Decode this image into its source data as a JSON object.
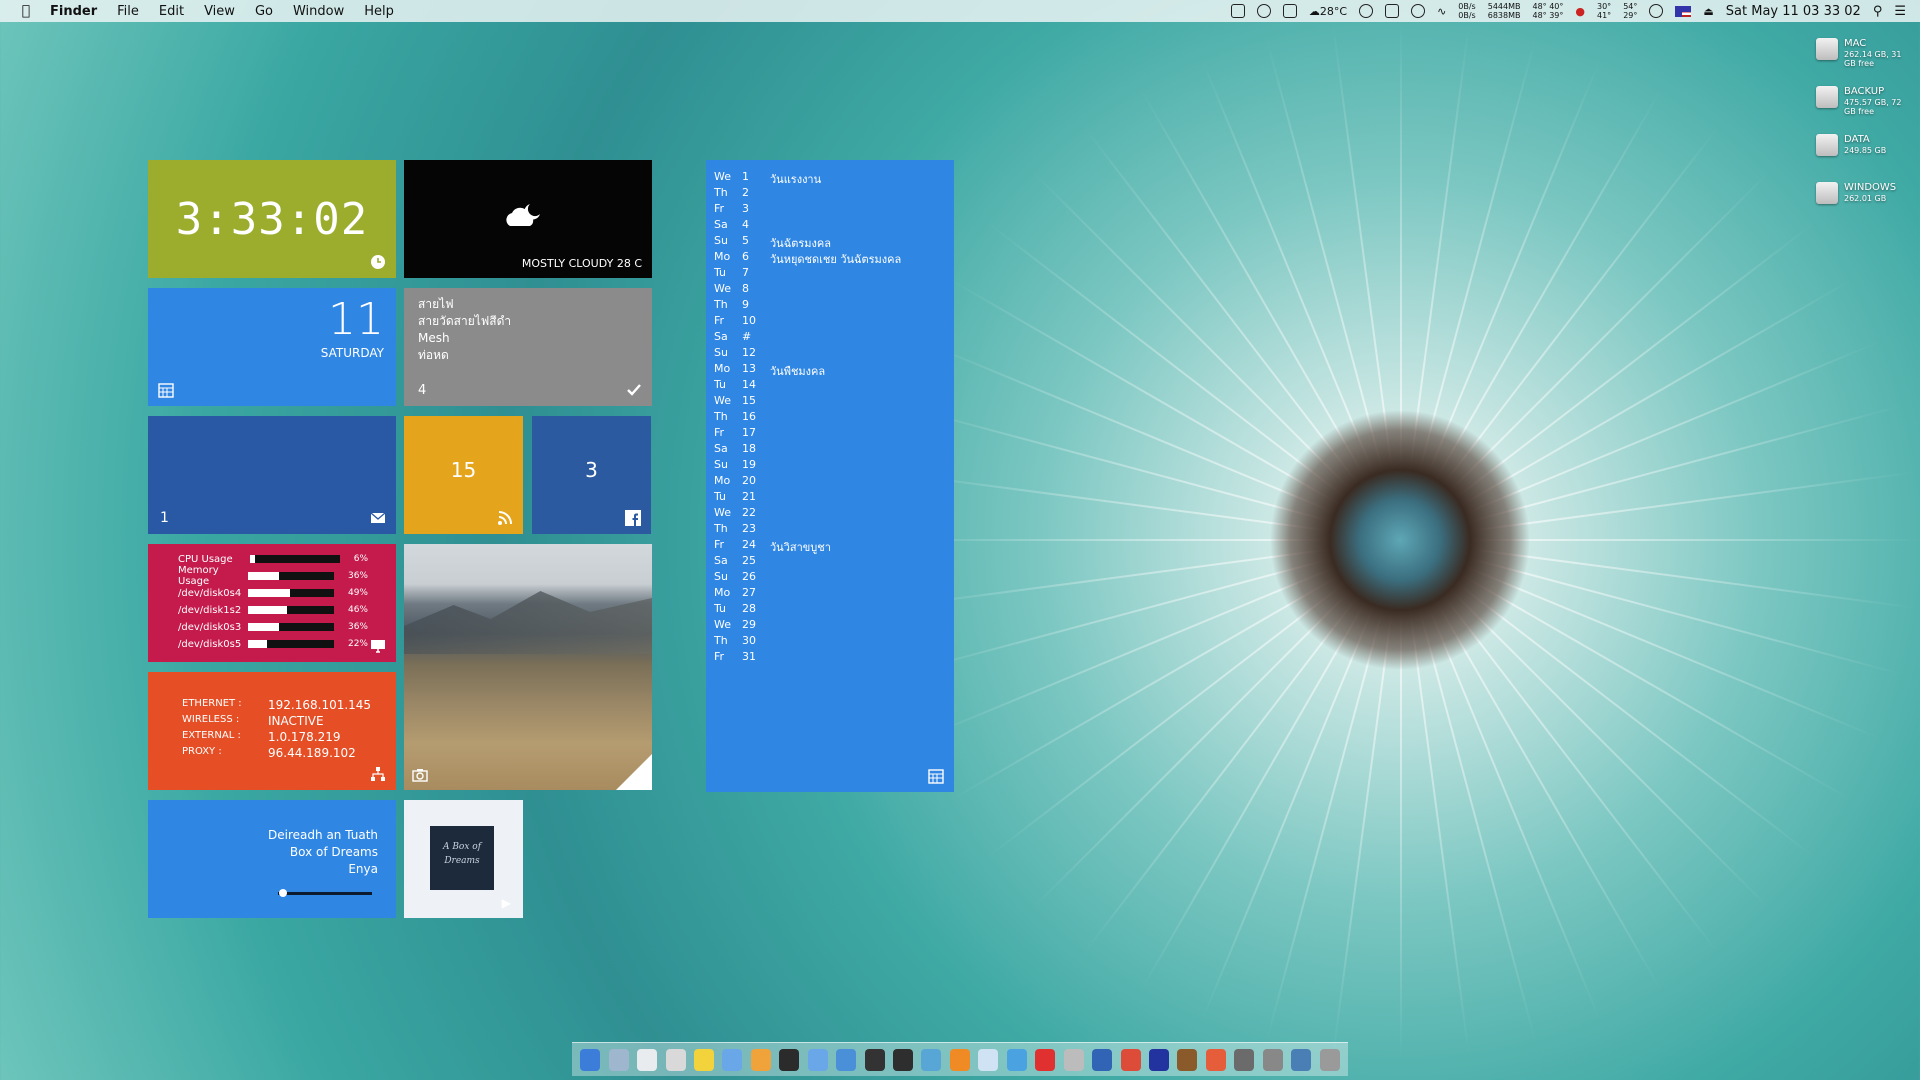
{
  "menubar": {
    "app_name": "Finder",
    "menus": [
      "File",
      "Edit",
      "View",
      "Go",
      "Window",
      "Help"
    ],
    "weather_temp": "28°C",
    "net_up": "0B/s",
    "net_down": "0B/s",
    "mem_top": "5444MB",
    "mem_bottom": "6838MB",
    "temp_top": "48° 40°",
    "temp_bottom": "48° 39°",
    "fan_top": "30°",
    "fan_bottom": "41°",
    "hdd_top": "54°",
    "hdd_bottom": "29°",
    "datetime": "Sat May 11  03 33 02"
  },
  "drives": [
    {
      "name": "MAC",
      "size": "262.14 GB, 31 GB free"
    },
    {
      "name": "BACKUP",
      "size": "475.57 GB, 72 GB free"
    },
    {
      "name": "DATA",
      "size": "249.85 GB"
    },
    {
      "name": "WINDOWS",
      "size": "262.01 GB"
    }
  ],
  "tiles": {
    "clock": {
      "time": "3:33:02"
    },
    "weather": {
      "caption": "MOSTLY CLOUDY 28 C"
    },
    "date": {
      "day": "11",
      "weekday": "SATURDAY"
    },
    "reminders": {
      "items": [
        "สายไฟ",
        "สายวัดสายไฟสีดำ",
        "Mesh",
        "ท่อหด"
      ],
      "count": "4"
    },
    "mail": {
      "count": "1"
    },
    "rss": {
      "count": "15"
    },
    "facebook": {
      "count": "3"
    },
    "stats": [
      {
        "label": "CPU Usage",
        "value": 6,
        "pct": "6%"
      },
      {
        "label": "Memory Usage",
        "value": 36,
        "pct": "36%"
      },
      {
        "label": "/dev/disk0s4",
        "value": 49,
        "pct": "49%"
      },
      {
        "label": "/dev/disk1s2",
        "value": 46,
        "pct": "46%"
      },
      {
        "label": "/dev/disk0s3",
        "value": 36,
        "pct": "36%"
      },
      {
        "label": "/dev/disk0s5",
        "value": 22,
        "pct": "22%"
      }
    ],
    "network": [
      {
        "key": "ETHERNET :",
        "value": "192.168.101.145"
      },
      {
        "key": "WIRELESS :",
        "value": "INACTIVE"
      },
      {
        "key": "EXTERNAL :",
        "value": "1.0.178.219"
      },
      {
        "key": "PROXY    :",
        "value": "96.44.189.102"
      }
    ],
    "music": {
      "artist": "Deireadh an Tuath",
      "album": "Box of Dreams",
      "track": "Enya",
      "progress": 0.03
    },
    "album_art": {
      "text": "A Box of Dreams"
    }
  },
  "calendar": [
    {
      "wd": "We",
      "d": "1",
      "ev": "วันแรงงาน"
    },
    {
      "wd": "Th",
      "d": "2",
      "ev": ""
    },
    {
      "wd": "Fr",
      "d": "3",
      "ev": ""
    },
    {
      "wd": "Sa",
      "d": "4",
      "ev": ""
    },
    {
      "wd": "Su",
      "d": "5",
      "ev": "วันฉัตรมงคล"
    },
    {
      "wd": "Mo",
      "d": "6",
      "ev": "วันหยุดชดเชย วันฉัตรมงคล"
    },
    {
      "wd": "Tu",
      "d": "7",
      "ev": ""
    },
    {
      "wd": "We",
      "d": "8",
      "ev": ""
    },
    {
      "wd": "Th",
      "d": "9",
      "ev": ""
    },
    {
      "wd": "Fr",
      "d": "10",
      "ev": ""
    },
    {
      "wd": "Sa",
      "d": "#",
      "ev": ""
    },
    {
      "wd": "Su",
      "d": "12",
      "ev": ""
    },
    {
      "wd": "Mo",
      "d": "13",
      "ev": "วันพืชมงคล"
    },
    {
      "wd": "Tu",
      "d": "14",
      "ev": ""
    },
    {
      "wd": "We",
      "d": "15",
      "ev": ""
    },
    {
      "wd": "Th",
      "d": "16",
      "ev": ""
    },
    {
      "wd": "Fr",
      "d": "17",
      "ev": ""
    },
    {
      "wd": "Sa",
      "d": "18",
      "ev": ""
    },
    {
      "wd": "Su",
      "d": "19",
      "ev": ""
    },
    {
      "wd": "Mo",
      "d": "20",
      "ev": ""
    },
    {
      "wd": "Tu",
      "d": "21",
      "ev": ""
    },
    {
      "wd": "We",
      "d": "22",
      "ev": ""
    },
    {
      "wd": "Th",
      "d": "23",
      "ev": ""
    },
    {
      "wd": "Fr",
      "d": "24",
      "ev": "วันวิสาขบูชา"
    },
    {
      "wd": "Sa",
      "d": "25",
      "ev": ""
    },
    {
      "wd": "Su",
      "d": "26",
      "ev": ""
    },
    {
      "wd": "Mo",
      "d": "27",
      "ev": ""
    },
    {
      "wd": "Tu",
      "d": "28",
      "ev": ""
    },
    {
      "wd": "We",
      "d": "29",
      "ev": ""
    },
    {
      "wd": "Th",
      "d": "30",
      "ev": ""
    },
    {
      "wd": "Fr",
      "d": "31",
      "ev": ""
    }
  ],
  "dock_colors": [
    "#3b7dd8",
    "#9fb6cf",
    "#e9ecef",
    "#d9d9d9",
    "#f3d33b",
    "#6aa7e8",
    "#f0a23b",
    "#2b2b2b",
    "#6aa7e8",
    "#4a90d9",
    "#333333",
    "#2e2e2e",
    "#58a6d6",
    "#f08a24",
    "#cfe3f4",
    "#4aa3e0",
    "#e03030",
    "#bcbcbc",
    "#3264b5",
    "#dd4b39",
    "#2233a0",
    "#8a5a2b",
    "#e65d3b",
    "#6b6b6b",
    "#888888",
    "#4a7fb5",
    "#9a9a9a"
  ]
}
